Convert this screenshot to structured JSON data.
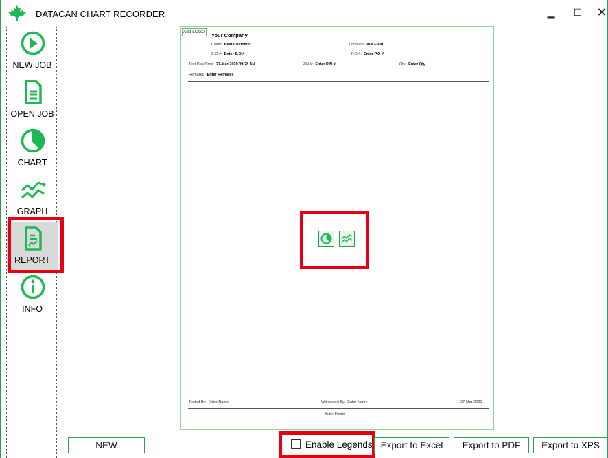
{
  "window": {
    "title": "DATACAN CHART RECORDER",
    "minimize": "▁",
    "maximize": "☐",
    "close": "✕"
  },
  "sidebar": {
    "items": [
      {
        "label": "NEW JOB",
        "icon": "play-icon"
      },
      {
        "label": "OPEN JOB",
        "icon": "document-icon"
      },
      {
        "label": "CHART",
        "icon": "pie-chart-icon"
      },
      {
        "label": "GRAPH",
        "icon": "line-graph-icon"
      },
      {
        "label": "REPORT",
        "icon": "report-icon",
        "active": true
      },
      {
        "label": "INFO",
        "icon": "info-icon"
      }
    ]
  },
  "report": {
    "add_logo": "Add LOGO",
    "company": "Your Company",
    "client_label": "Client:",
    "client_value": "Best Customer",
    "location_label": "Location:",
    "location_value": "In a Field",
    "so_label": "S.O #:",
    "so_value": "Enter S.O #",
    "po_label": "P.O #:",
    "po_value": "Enter P.O #",
    "test_datetime_label": "Test DateTime:",
    "test_datetime_value": "27-Mar-2020 09:28 AM",
    "pn_label": "P/N #:",
    "pn_value": "Enter P/N #",
    "qty_label": "Qty:",
    "qty_value": "Enter Qty",
    "remarks_label": "Remarks:",
    "remarks_value": "Enter Remarks",
    "tested_by_label": "Tested By:",
    "tested_by_value": "Enter Name",
    "witnessed_by_label": "Witnessed By:",
    "witnessed_by_value": "Enter Name",
    "date": "27-Mar-2020",
    "footer": "Enter Footer"
  },
  "bottom": {
    "new_label": "NEW",
    "enable_legends_label": "Enable Legends",
    "enable_legends_checked": false,
    "export_excel": "Export to Excel",
    "export_pdf": "Export to PDF",
    "export_xps": "Export to XPS"
  },
  "colors": {
    "accent": "#1db954",
    "highlight": "#e60012",
    "border": "#2e9e4f"
  }
}
